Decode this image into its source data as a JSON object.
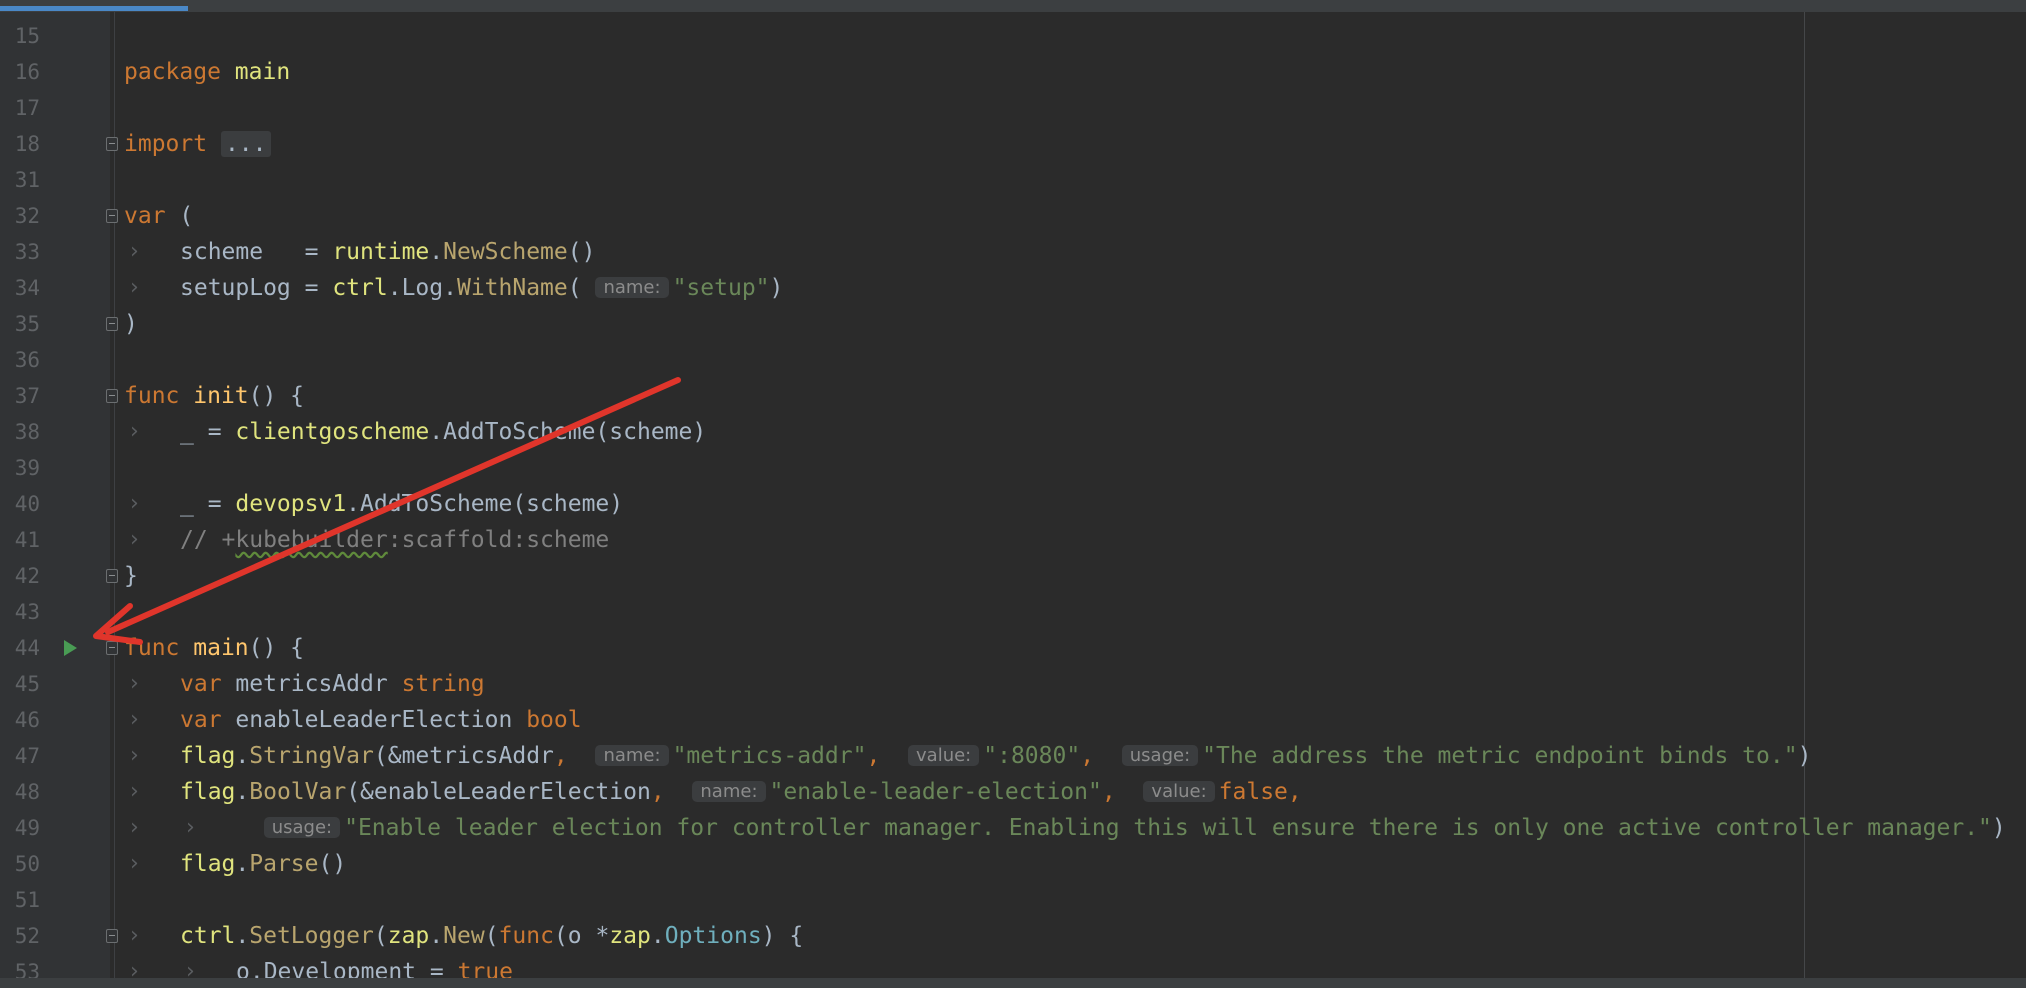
{
  "editor": {
    "tab_progress": 0.093,
    "colors": {
      "background": "#2b2b2b",
      "gutter": "#313335",
      "keyword": "#cc7832",
      "function": "#ffc66d",
      "string": "#6a8759",
      "comment": "#808080",
      "run_icon": "#499c54",
      "annotation_arrow": "#e0352b"
    },
    "lines": [
      {
        "n": "15",
        "tokens": []
      },
      {
        "n": "16",
        "tokens": [
          {
            "t": "package",
            "c": "kw"
          },
          {
            "t": " "
          },
          {
            "t": "main",
            "c": "pk"
          }
        ]
      },
      {
        "n": "17",
        "tokens": []
      },
      {
        "n": "18",
        "fold": true,
        "tokens": [
          {
            "t": "import",
            "c": "kw"
          },
          {
            "t": " "
          },
          {
            "t": "...",
            "c": "folded"
          }
        ]
      },
      {
        "n": "31",
        "tokens": []
      },
      {
        "n": "32",
        "fold": true,
        "tokens": [
          {
            "t": "var",
            "c": "kw"
          },
          {
            "t": " ("
          }
        ]
      },
      {
        "n": "33",
        "chev": 1,
        "tokens": [
          {
            "t": "scheme   = "
          },
          {
            "t": "runtime",
            "c": "pk"
          },
          {
            "t": "."
          },
          {
            "t": "NewScheme",
            "c": "md"
          },
          {
            "t": "()"
          }
        ]
      },
      {
        "n": "34",
        "chev": 1,
        "tokens": [
          {
            "t": "setupLog = "
          },
          {
            "t": "ctrl",
            "c": "pk"
          },
          {
            "t": ".Log."
          },
          {
            "t": "WithName",
            "c": "md"
          },
          {
            "t": "( "
          },
          {
            "t": "name:",
            "c": "hint"
          },
          {
            "t": "\"setup\"",
            "c": "st"
          },
          {
            "t": ")"
          }
        ]
      },
      {
        "n": "35",
        "fold": true,
        "tokens": [
          {
            "t": ")"
          }
        ]
      },
      {
        "n": "36",
        "tokens": []
      },
      {
        "n": "37",
        "fold": true,
        "tokens": [
          {
            "t": "func",
            "c": "kw"
          },
          {
            "t": " "
          },
          {
            "t": "init",
            "c": "fn"
          },
          {
            "t": "() {"
          }
        ]
      },
      {
        "n": "38",
        "chev": 1,
        "tokens": [
          {
            "t": "_ = "
          },
          {
            "t": "clientgoscheme",
            "c": "pk"
          },
          {
            "t": ".AddToScheme(scheme)"
          }
        ]
      },
      {
        "n": "39",
        "tokens": []
      },
      {
        "n": "40",
        "chev": 1,
        "tokens": [
          {
            "t": "_ = "
          },
          {
            "t": "devopsv1",
            "c": "pk"
          },
          {
            "t": ".AddToScheme(scheme)"
          }
        ]
      },
      {
        "n": "41",
        "chev": 1,
        "tokens": [
          {
            "t": "// +",
            "c": "cm"
          },
          {
            "t": "kubebuilder",
            "c": "cm squiggle"
          },
          {
            "t": ":scaffold:scheme",
            "c": "cm"
          }
        ]
      },
      {
        "n": "42",
        "fold": true,
        "tokens": [
          {
            "t": "}"
          }
        ]
      },
      {
        "n": "43",
        "tokens": []
      },
      {
        "n": "44",
        "fold": true,
        "run": true,
        "tokens": [
          {
            "t": "func",
            "c": "kw"
          },
          {
            "t": " "
          },
          {
            "t": "main",
            "c": "fn"
          },
          {
            "t": "() {"
          }
        ]
      },
      {
        "n": "45",
        "chev": 1,
        "tokens": [
          {
            "t": "var",
            "c": "kw"
          },
          {
            "t": " metricsAddr "
          },
          {
            "t": "string",
            "c": "kw"
          }
        ]
      },
      {
        "n": "46",
        "chev": 1,
        "tokens": [
          {
            "t": "var",
            "c": "kw"
          },
          {
            "t": " enableLeaderElection "
          },
          {
            "t": "bool",
            "c": "kw"
          }
        ]
      },
      {
        "n": "47",
        "chev": 1,
        "tokens": [
          {
            "t": "flag",
            "c": "pk"
          },
          {
            "t": "."
          },
          {
            "t": "StringVar",
            "c": "md"
          },
          {
            "t": "(&metricsAddr"
          },
          {
            "t": ",",
            "c": "kw"
          },
          {
            "t": "  "
          },
          {
            "t": "name:",
            "c": "hint"
          },
          {
            "t": "\"metrics-addr\"",
            "c": "st"
          },
          {
            "t": ",",
            "c": "kw"
          },
          {
            "t": "  "
          },
          {
            "t": "value:",
            "c": "hint"
          },
          {
            "t": "\":8080\"",
            "c": "st"
          },
          {
            "t": ",",
            "c": "kw"
          },
          {
            "t": "  "
          },
          {
            "t": "usage:",
            "c": "hint"
          },
          {
            "t": "\"The address the metric endpoint binds to.\"",
            "c": "st"
          },
          {
            "t": ")"
          }
        ]
      },
      {
        "n": "48",
        "chev": 1,
        "tokens": [
          {
            "t": "flag",
            "c": "pk"
          },
          {
            "t": "."
          },
          {
            "t": "BoolVar",
            "c": "md"
          },
          {
            "t": "(&enableLeaderElection"
          },
          {
            "t": ",",
            "c": "kw"
          },
          {
            "t": "  "
          },
          {
            "t": "name:",
            "c": "hint"
          },
          {
            "t": "\"enable-leader-election\"",
            "c": "st"
          },
          {
            "t": ",",
            "c": "kw"
          },
          {
            "t": "  "
          },
          {
            "t": "value:",
            "c": "hint"
          },
          {
            "t": "false",
            "c": "kw"
          },
          {
            "t": ",",
            "c": "kw"
          }
        ]
      },
      {
        "n": "49",
        "chev": 2,
        "tokens": [
          {
            "t": "  "
          },
          {
            "t": "usage:",
            "c": "hint"
          },
          {
            "t": "\"Enable leader election for controller manager. Enabling this will ensure there is only one active controller manager.\"",
            "c": "st"
          },
          {
            "t": ")"
          }
        ]
      },
      {
        "n": "50",
        "chev": 1,
        "tokens": [
          {
            "t": "flag",
            "c": "pk"
          },
          {
            "t": "."
          },
          {
            "t": "Parse",
            "c": "md"
          },
          {
            "t": "()"
          }
        ]
      },
      {
        "n": "51",
        "tokens": []
      },
      {
        "n": "52",
        "fold": true,
        "chev": 1,
        "tokens": [
          {
            "t": "ctrl",
            "c": "pk"
          },
          {
            "t": "."
          },
          {
            "t": "SetLogger",
            "c": "md"
          },
          {
            "t": "("
          },
          {
            "t": "zap",
            "c": "pk"
          },
          {
            "t": "."
          },
          {
            "t": "New",
            "c": "md"
          },
          {
            "t": "("
          },
          {
            "t": "func",
            "c": "kw"
          },
          {
            "t": "(o *"
          },
          {
            "t": "zap",
            "c": "pk"
          },
          {
            "t": "."
          },
          {
            "t": "Options",
            "c": "ty"
          },
          {
            "t": ") {"
          }
        ]
      },
      {
        "n": "53",
        "chev": 2,
        "tokens": [
          {
            "t": "o.Development = "
          },
          {
            "t": "true",
            "c": "kw"
          }
        ]
      }
    ]
  }
}
